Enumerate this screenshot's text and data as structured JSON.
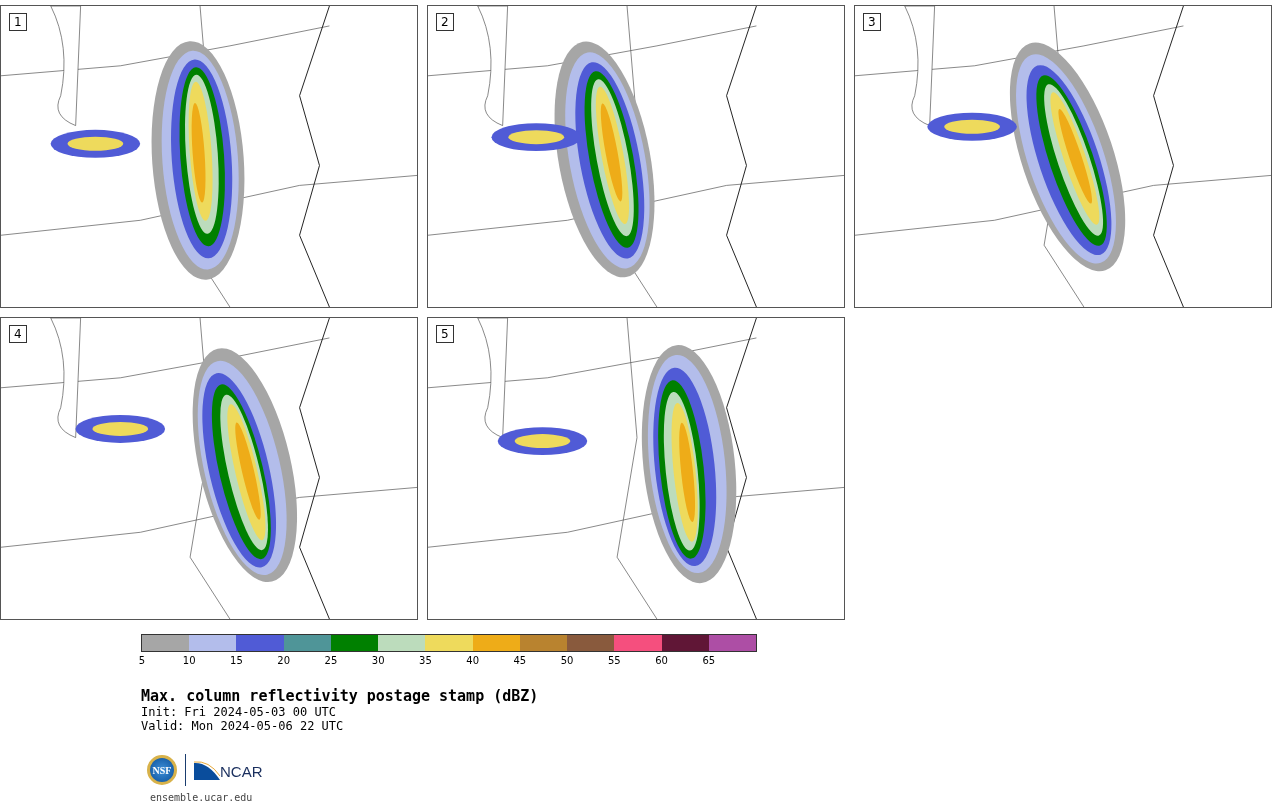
{
  "panels": [
    {
      "number": "1"
    },
    {
      "number": "2"
    },
    {
      "number": "3"
    },
    {
      "number": "4"
    },
    {
      "number": "5"
    }
  ],
  "colorbar": {
    "segments": [
      {
        "color": "#a6a6a6",
        "tick": "5"
      },
      {
        "color": "#b3bdeb",
        "tick": "10"
      },
      {
        "color": "#505bd6",
        "tick": "15"
      },
      {
        "color": "#4f9598",
        "tick": "20"
      },
      {
        "color": "#008000",
        "tick": "25"
      },
      {
        "color": "#bcdcbc",
        "tick": "30"
      },
      {
        "color": "#eeda5c",
        "tick": "35"
      },
      {
        "color": "#eeac18",
        "tick": "40"
      },
      {
        "color": "#b9832f",
        "tick": "45"
      },
      {
        "color": "#895a3d",
        "tick": "50"
      },
      {
        "color": "#f54f7e",
        "tick": "55"
      },
      {
        "color": "#601636",
        "tick": "60"
      },
      {
        "color": "#ad4ea5",
        "tick": "65"
      }
    ]
  },
  "title": "Max. column reflectivity postage stamp (dBZ)",
  "init": " Init: Fri 2024-05-03 00 UTC",
  "valid": "Valid: Mon 2024-05-06 22 UTC",
  "logos": {
    "nsf": "NSF",
    "ncar": "NCAR"
  },
  "website": "ensemble.ucar.edu"
}
